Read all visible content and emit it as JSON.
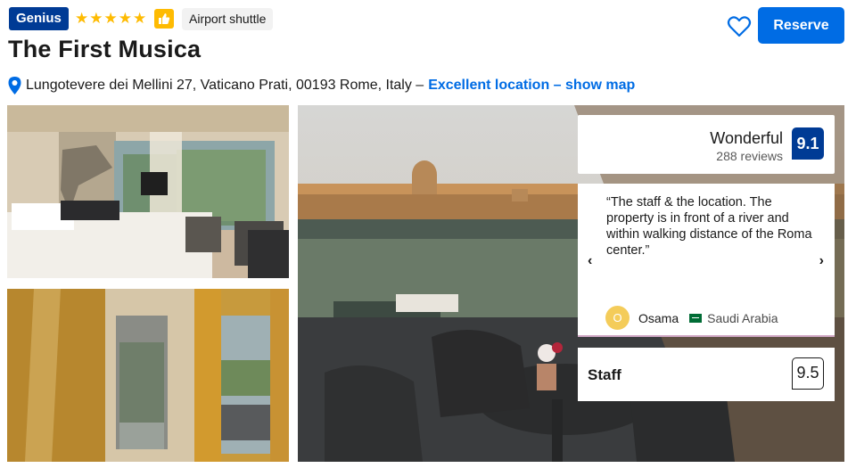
{
  "header": {
    "genius_badge": "Genius",
    "stars": 5,
    "star_icon": "star-icon",
    "thumbs_icon": "thumbs-up-icon",
    "amenity_tag": "Airport shuttle",
    "save_icon": "heart-icon",
    "reserve_label": "Reserve"
  },
  "property": {
    "name": "The First Musica",
    "address": "Lungotevere dei Mellini 27, Vaticano Prati, 00193 Rome, Italy –",
    "location_link": "Excellent location – show map",
    "pin_icon": "map-pin-icon"
  },
  "rating": {
    "label": "Wonderful",
    "reviews": "288 reviews",
    "score": "9.1"
  },
  "review": {
    "quote": "“The staff & the location. The property is in front of a river and within walking distance of the Roma center.”",
    "reviewer_initial": "O",
    "reviewer_name": "Osama",
    "country": "Saudi Arabia",
    "prev_icon": "chevron-left-icon",
    "next_icon": "chevron-right-icon"
  },
  "category": {
    "label": "Staff",
    "score": "9.5"
  },
  "colors": {
    "brand_blue": "#003b95",
    "action_blue": "#006ce4",
    "star_yellow": "#febb02"
  }
}
